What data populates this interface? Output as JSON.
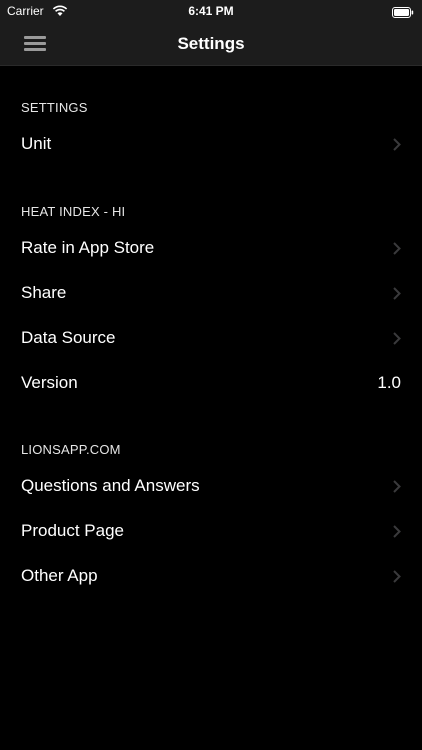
{
  "status_bar": {
    "carrier": "Carrier",
    "time": "6:41 PM"
  },
  "nav": {
    "title": "Settings",
    "menu_icon": "hamburger-menu-icon"
  },
  "sections": [
    {
      "header": "SETTINGS",
      "rows": [
        {
          "label": "Unit",
          "accessory": "chevron"
        }
      ]
    },
    {
      "header": "HEAT INDEX - HI",
      "rows": [
        {
          "label": "Rate in App Store",
          "accessory": "chevron"
        },
        {
          "label": "Share",
          "accessory": "chevron"
        },
        {
          "label": "Data Source",
          "accessory": "chevron"
        },
        {
          "label": "Version",
          "value": "1.0"
        }
      ]
    },
    {
      "header": "LIONSAPP.COM",
      "rows": [
        {
          "label": "Questions and Answers",
          "accessory": "chevron"
        },
        {
          "label": "Product Page",
          "accessory": "chevron"
        },
        {
          "label": "Other App",
          "accessory": "chevron"
        }
      ]
    }
  ],
  "colors": {
    "background": "#000000",
    "bar_background": "#1c1c1c",
    "chevron": "#3a3a3c",
    "text": "#ffffff"
  }
}
